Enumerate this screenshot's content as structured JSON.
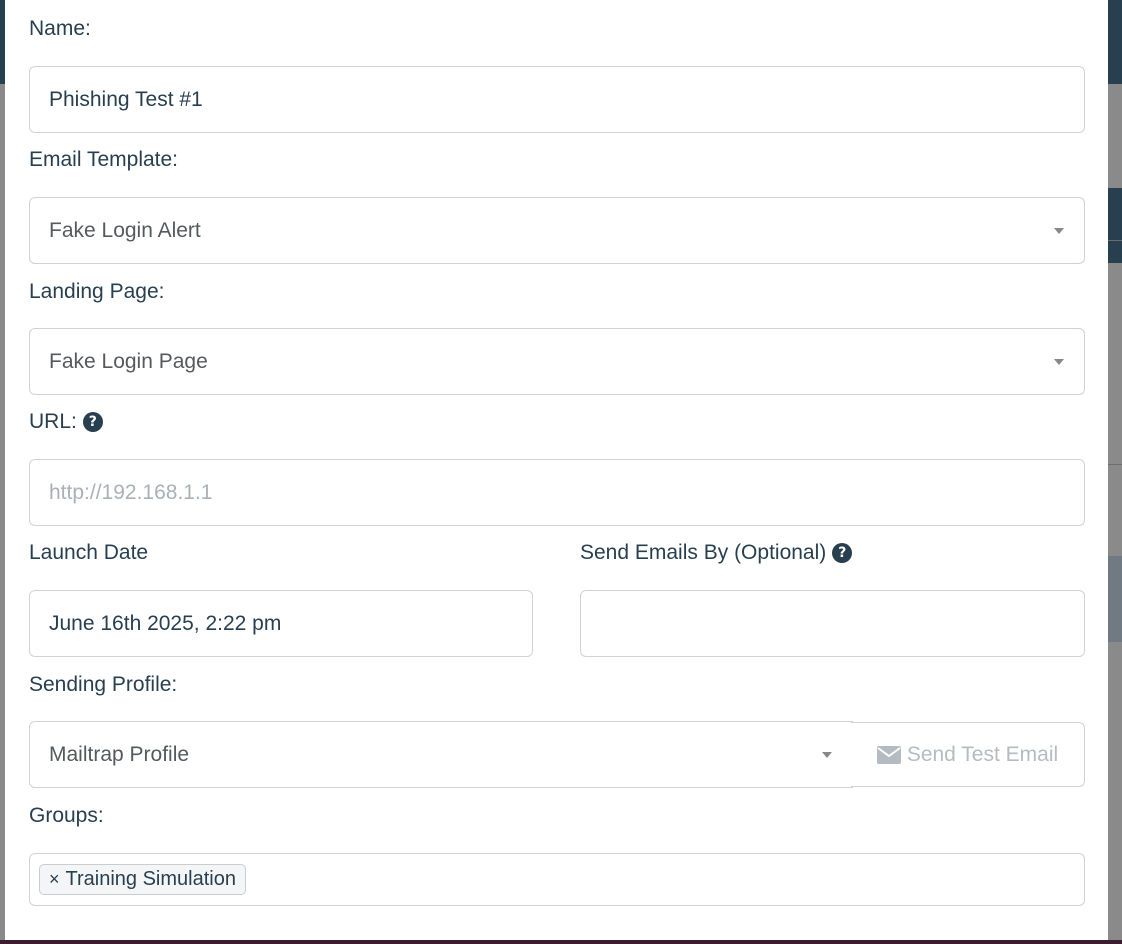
{
  "form": {
    "name": {
      "label": "Name:",
      "value": "Phishing Test #1"
    },
    "email_template": {
      "label": "Email Template:",
      "value": "Fake Login Alert"
    },
    "landing_page": {
      "label": "Landing Page:",
      "value": "Fake Login Page"
    },
    "url": {
      "label": "URL:",
      "value": "",
      "placeholder": "http://192.168.1.1",
      "help_icon": "question-circle-icon"
    },
    "launch_date": {
      "label": "Launch Date",
      "value": "June 16th 2025, 2:22 pm"
    },
    "send_by": {
      "label": "Send Emails By (Optional)",
      "value": "",
      "help_icon": "question-circle-icon"
    },
    "sending_profile": {
      "label": "Sending Profile:",
      "value": "Mailtrap Profile",
      "test_button": "Send Test Email",
      "test_button_icon": "envelope-icon"
    },
    "groups": {
      "label": "Groups:",
      "tags": [
        {
          "remove": "×",
          "label": "Training Simulation"
        }
      ]
    }
  },
  "colors": {
    "text": "#283f50",
    "border": "#cfd3d6",
    "placeholder": "#a9b1b7"
  }
}
